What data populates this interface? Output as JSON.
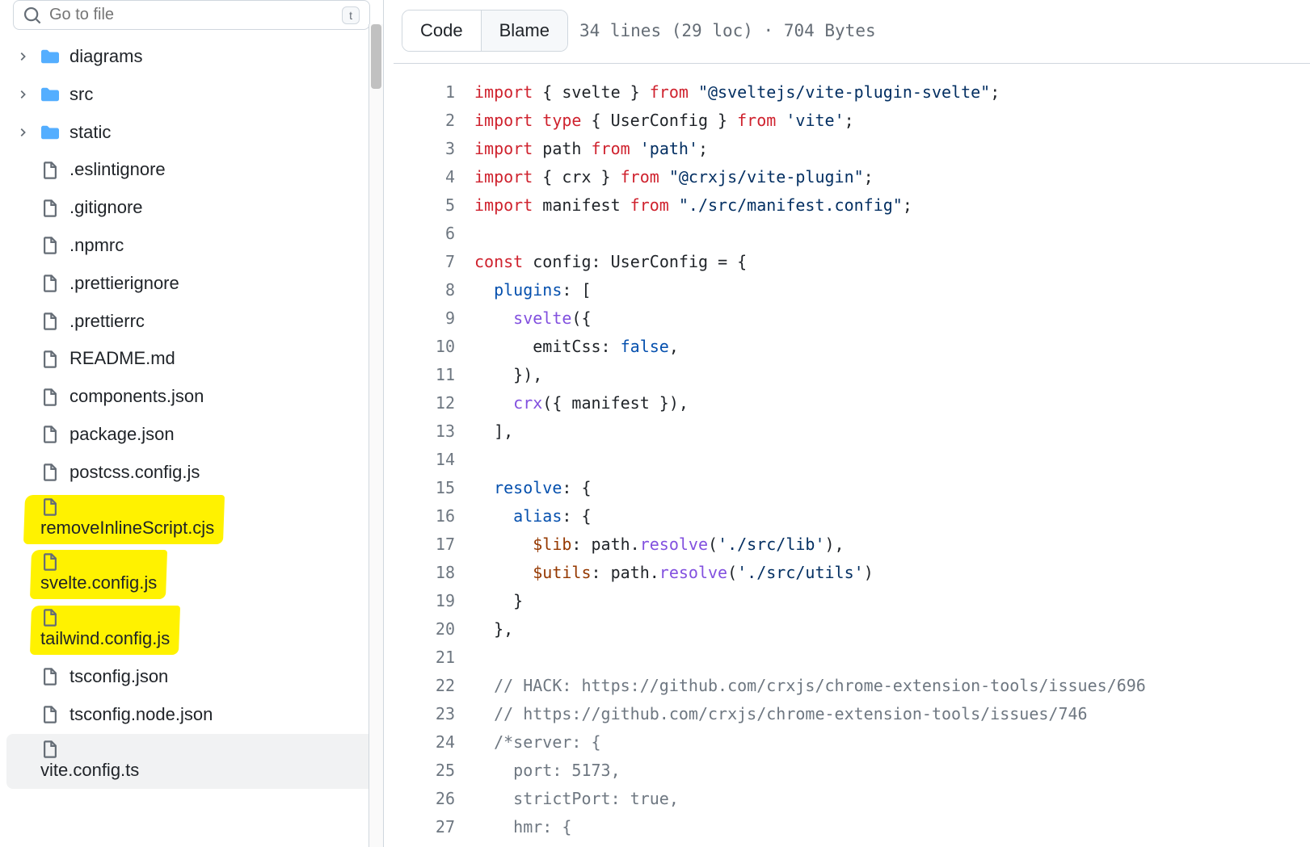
{
  "search": {
    "placeholder": "Go to file",
    "shortcut": "t"
  },
  "tree": [
    {
      "type": "folder",
      "name": "diagrams",
      "expandable": true
    },
    {
      "type": "folder",
      "name": "src",
      "expandable": true
    },
    {
      "type": "folder",
      "name": "static",
      "expandable": true
    },
    {
      "type": "file",
      "name": ".eslintignore"
    },
    {
      "type": "file",
      "name": ".gitignore"
    },
    {
      "type": "file",
      "name": ".npmrc"
    },
    {
      "type": "file",
      "name": ".prettierignore"
    },
    {
      "type": "file",
      "name": ".prettierrc"
    },
    {
      "type": "file",
      "name": "README.md"
    },
    {
      "type": "file",
      "name": "components.json"
    },
    {
      "type": "file",
      "name": "package.json"
    },
    {
      "type": "file",
      "name": "postcss.config.js"
    },
    {
      "type": "file",
      "name": "removeInlineScript.cjs",
      "highlight": true
    },
    {
      "type": "file",
      "name": "svelte.config.js",
      "highlight": true
    },
    {
      "type": "file",
      "name": "tailwind.config.js",
      "highlight": true
    },
    {
      "type": "file",
      "name": "tsconfig.json"
    },
    {
      "type": "file",
      "name": "tsconfig.node.json"
    },
    {
      "type": "file",
      "name": "vite.config.ts",
      "highlight": true,
      "active": true
    }
  ],
  "tabs": {
    "code": "Code",
    "blame": "Blame",
    "active": "code"
  },
  "meta": "34 lines (29 loc) · 704 Bytes",
  "code": {
    "lines": [
      {
        "n": 1,
        "tokens": [
          [
            "kw",
            "import"
          ],
          [
            "",
            " { "
          ],
          [
            "ident",
            "svelte"
          ],
          [
            "",
            " } "
          ],
          [
            "kw",
            "from"
          ],
          [
            "",
            " "
          ],
          [
            "str",
            "\"@sveltejs/vite-plugin-svelte\""
          ],
          [
            "",
            ";"
          ]
        ]
      },
      {
        "n": 2,
        "tokens": [
          [
            "kw",
            "import"
          ],
          [
            "",
            " "
          ],
          [
            "kw",
            "type"
          ],
          [
            "",
            " { "
          ],
          [
            "type",
            "UserConfig"
          ],
          [
            "",
            " } "
          ],
          [
            "kw",
            "from"
          ],
          [
            "",
            " "
          ],
          [
            "str",
            "'vite'"
          ],
          [
            "",
            ";"
          ]
        ]
      },
      {
        "n": 3,
        "tokens": [
          [
            "kw",
            "import"
          ],
          [
            "",
            " "
          ],
          [
            "ident",
            "path"
          ],
          [
            "",
            " "
          ],
          [
            "kw",
            "from"
          ],
          [
            "",
            " "
          ],
          [
            "str",
            "'path'"
          ],
          [
            "",
            ";"
          ]
        ]
      },
      {
        "n": 4,
        "highlight": true,
        "tokens": [
          [
            "kw",
            "import"
          ],
          [
            "",
            " { "
          ],
          [
            "ident",
            "crx"
          ],
          [
            "",
            " } "
          ],
          [
            "kw",
            "from"
          ],
          [
            "",
            " "
          ],
          [
            "str",
            "\"@crxjs/vite-plugin\""
          ],
          [
            "",
            ";"
          ]
        ]
      },
      {
        "n": 5,
        "highlight": true,
        "tokens": [
          [
            "kw",
            "import"
          ],
          [
            "",
            " "
          ],
          [
            "ident",
            "manifest"
          ],
          [
            "",
            " "
          ],
          [
            "kw",
            "from"
          ],
          [
            "",
            " "
          ],
          [
            "str",
            "\"./src/manifest.config\""
          ],
          [
            "",
            ";"
          ]
        ]
      },
      {
        "n": 6,
        "tokens": []
      },
      {
        "n": 7,
        "tokens": [
          [
            "kw",
            "const"
          ],
          [
            "",
            " "
          ],
          [
            "ident",
            "config"
          ],
          [
            "",
            ": "
          ],
          [
            "type",
            "UserConfig"
          ],
          [
            "",
            " = {"
          ]
        ]
      },
      {
        "n": 8,
        "tokens": [
          [
            "",
            "  "
          ],
          [
            "prop",
            "plugins"
          ],
          [
            "",
            ": ["
          ]
        ]
      },
      {
        "n": 9,
        "tokens": [
          [
            "",
            "    "
          ],
          [
            "fn",
            "svelte"
          ],
          [
            "",
            "({"
          ]
        ]
      },
      {
        "n": 10,
        "tokens": [
          [
            "",
            "      "
          ],
          [
            "ident",
            "emitCss"
          ],
          [
            "",
            ": "
          ],
          [
            "bool",
            "false"
          ],
          [
            "",
            ","
          ]
        ]
      },
      {
        "n": 11,
        "tokens": [
          [
            "",
            "    }),"
          ]
        ]
      },
      {
        "n": 12,
        "highlight": "small",
        "indent": 4,
        "tokens": [
          [
            "",
            "    "
          ],
          [
            "fn",
            "crx"
          ],
          [
            "",
            "({ "
          ],
          [
            "ident",
            "manifest"
          ],
          [
            "",
            " }),"
          ]
        ]
      },
      {
        "n": 13,
        "tokens": [
          [
            "",
            "  ],"
          ]
        ]
      },
      {
        "n": 14,
        "tokens": []
      },
      {
        "n": 15,
        "tokens": [
          [
            "",
            "  "
          ],
          [
            "prop",
            "resolve"
          ],
          [
            "",
            ": {"
          ]
        ]
      },
      {
        "n": 16,
        "tokens": [
          [
            "",
            "    "
          ],
          [
            "prop",
            "alias"
          ],
          [
            "",
            ": {"
          ]
        ]
      },
      {
        "n": 17,
        "tokens": [
          [
            "",
            "      "
          ],
          [
            "var",
            "$lib"
          ],
          [
            "",
            ": path."
          ],
          [
            "fn",
            "resolve"
          ],
          [
            "",
            "("
          ],
          [
            "str",
            "'./src/lib'"
          ],
          [
            "",
            "),"
          ]
        ]
      },
      {
        "n": 18,
        "tokens": [
          [
            "",
            "      "
          ],
          [
            "var",
            "$utils"
          ],
          [
            "",
            ": path."
          ],
          [
            "fn",
            "resolve"
          ],
          [
            "",
            "("
          ],
          [
            "str",
            "'./src/utils'"
          ],
          [
            "",
            ")"
          ]
        ]
      },
      {
        "n": 19,
        "tokens": [
          [
            "",
            "    }"
          ]
        ]
      },
      {
        "n": 20,
        "tokens": [
          [
            "",
            "  },"
          ]
        ]
      },
      {
        "n": 21,
        "tokens": []
      },
      {
        "n": 22,
        "tokens": [
          [
            "",
            "  "
          ],
          [
            "cmt",
            "// HACK: https://github.com/crxjs/chrome-extension-tools/issues/696"
          ]
        ]
      },
      {
        "n": 23,
        "tokens": [
          [
            "",
            "  "
          ],
          [
            "cmt",
            "// https://github.com/crxjs/chrome-extension-tools/issues/746"
          ]
        ]
      },
      {
        "n": 24,
        "tokens": [
          [
            "",
            "  "
          ],
          [
            "cmt",
            "/*server: {"
          ]
        ]
      },
      {
        "n": 25,
        "tokens": [
          [
            "",
            "    "
          ],
          [
            "cmt",
            "port: 5173,"
          ]
        ]
      },
      {
        "n": 26,
        "tokens": [
          [
            "",
            "    "
          ],
          [
            "cmt",
            "strictPort: true,"
          ]
        ]
      },
      {
        "n": 27,
        "tokens": [
          [
            "",
            "    "
          ],
          [
            "cmt",
            "hmr: {"
          ]
        ]
      }
    ]
  }
}
